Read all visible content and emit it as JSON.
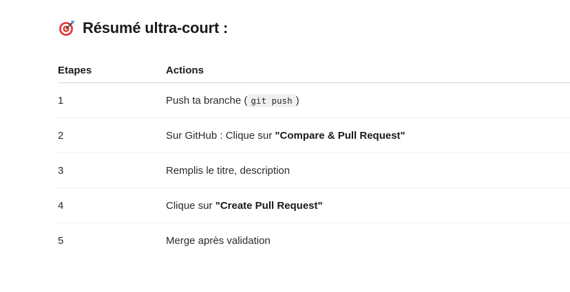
{
  "heading": {
    "icon": "target-dart-icon",
    "title": "Résumé ultra-court :"
  },
  "table": {
    "headers": [
      "Etapes",
      "Actions"
    ],
    "rows": [
      {
        "step": "1",
        "before": "Push ta branche (",
        "code": "git push",
        "after": ")"
      },
      {
        "step": "2",
        "before": "Sur GitHub : Clique sur ",
        "bold": "\"Compare & Pull Request\"",
        "after": ""
      },
      {
        "step": "3",
        "before": "Remplis le titre, description",
        "after": ""
      },
      {
        "step": "4",
        "before": "Clique sur ",
        "bold": "\"Create Pull Request\"",
        "after": ""
      },
      {
        "step": "5",
        "before": "Merge après validation",
        "after": ""
      }
    ]
  }
}
